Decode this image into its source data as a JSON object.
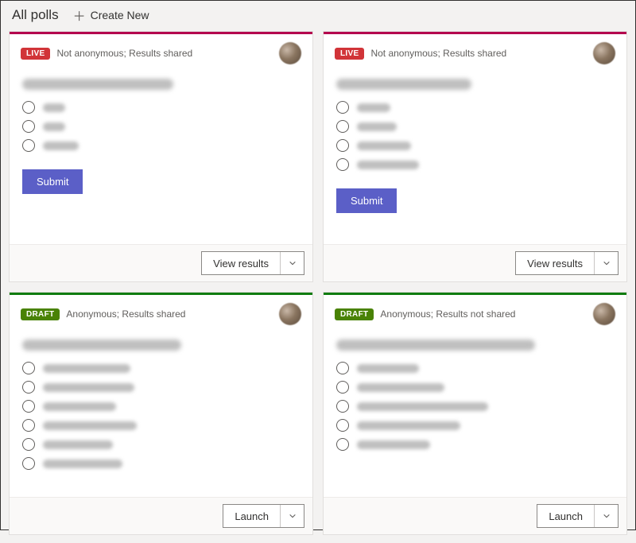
{
  "header": {
    "title": "All polls",
    "create_label": "Create New"
  },
  "polls": [
    {
      "status_label": "LIVE",
      "status_class": "live",
      "meta": "Not anonymous; Results shared",
      "question_width": 190,
      "options_widths": [
        28,
        28,
        45
      ],
      "primary_action": "Submit",
      "footer_action": "View results"
    },
    {
      "status_label": "LIVE",
      "status_class": "live",
      "meta": "Not anonymous; Results shared",
      "question_width": 170,
      "options_widths": [
        42,
        50,
        68,
        78
      ],
      "primary_action": "Submit",
      "footer_action": "View results"
    },
    {
      "status_label": "DRAFT",
      "status_class": "draft",
      "meta": "Anonymous; Results shared",
      "question_width": 200,
      "options_widths": [
        110,
        115,
        92,
        118,
        88,
        100
      ],
      "primary_action": null,
      "footer_action": "Launch"
    },
    {
      "status_label": "DRAFT",
      "status_class": "draft",
      "meta": "Anonymous; Results not shared",
      "question_width": 250,
      "options_widths": [
        78,
        110,
        165,
        130,
        92
      ],
      "primary_action": null,
      "footer_action": "Launch"
    }
  ]
}
